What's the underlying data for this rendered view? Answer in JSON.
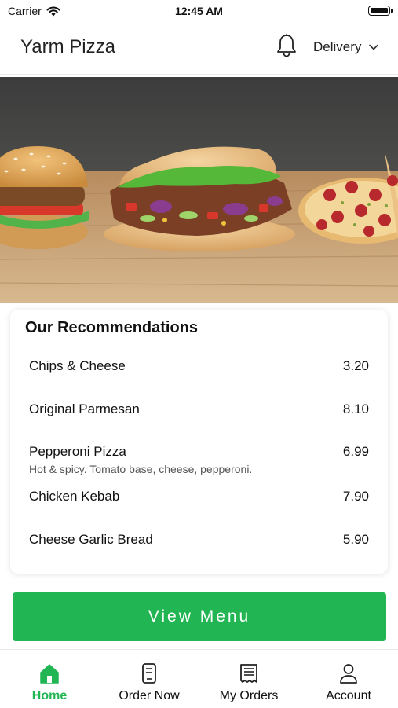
{
  "status_bar": {
    "carrier": "Carrier",
    "time": "12:45 AM"
  },
  "header": {
    "title": "Yarm Pizza",
    "delivery_label": "Delivery"
  },
  "recommendations": {
    "title": "Our Recommendations",
    "items": [
      {
        "name": "Chips & Cheese",
        "price": "3.20",
        "description": ""
      },
      {
        "name": "Original Parmesan",
        "price": "8.10",
        "description": ""
      },
      {
        "name": "Pepperoni Pizza",
        "price": "6.99",
        "description": "Hot & spicy. Tomato base, cheese, pepperoni."
      },
      {
        "name": "Chicken Kebab",
        "price": "7.90",
        "description": ""
      },
      {
        "name": "Cheese Garlic Bread",
        "price": "5.90",
        "description": ""
      }
    ]
  },
  "view_menu_label": "View Menu",
  "bottom_nav": {
    "items": [
      {
        "label": "Home",
        "icon": "home-icon",
        "active": true
      },
      {
        "label": "Order Now",
        "icon": "order-icon",
        "active": false
      },
      {
        "label": "My Orders",
        "icon": "receipt-icon",
        "active": false
      },
      {
        "label": "Account",
        "icon": "person-icon",
        "active": false
      }
    ]
  },
  "colors": {
    "accent": "#21b653",
    "text": "#111111",
    "muted": "#555555"
  }
}
